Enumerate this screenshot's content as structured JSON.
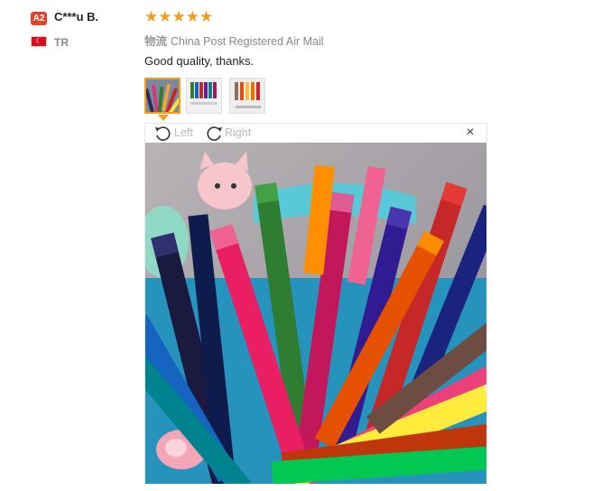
{
  "reviewer": {
    "badge": "A2",
    "name": "C***u B.",
    "country_code": "TR",
    "flag_icon": "turkey-flag-icon"
  },
  "rating": {
    "stars": 5,
    "max": 5,
    "display": "★★★★★",
    "color": "#f79a1a"
  },
  "logistics": {
    "label": "物流",
    "value": "China Post Registered Air Mail"
  },
  "review_text": "Good quality, thanks.",
  "thumbnails": [
    {
      "name": "thumbnail-1",
      "active": true
    },
    {
      "name": "thumbnail-2",
      "active": false
    },
    {
      "name": "thumbnail-3",
      "active": false
    }
  ],
  "viewer": {
    "rotate_left_label": "Left",
    "rotate_right_label": "Right",
    "close_label": "×"
  },
  "colors": {
    "accent": "#f59a23",
    "badge": "#e0452b",
    "muted": "#888888"
  }
}
